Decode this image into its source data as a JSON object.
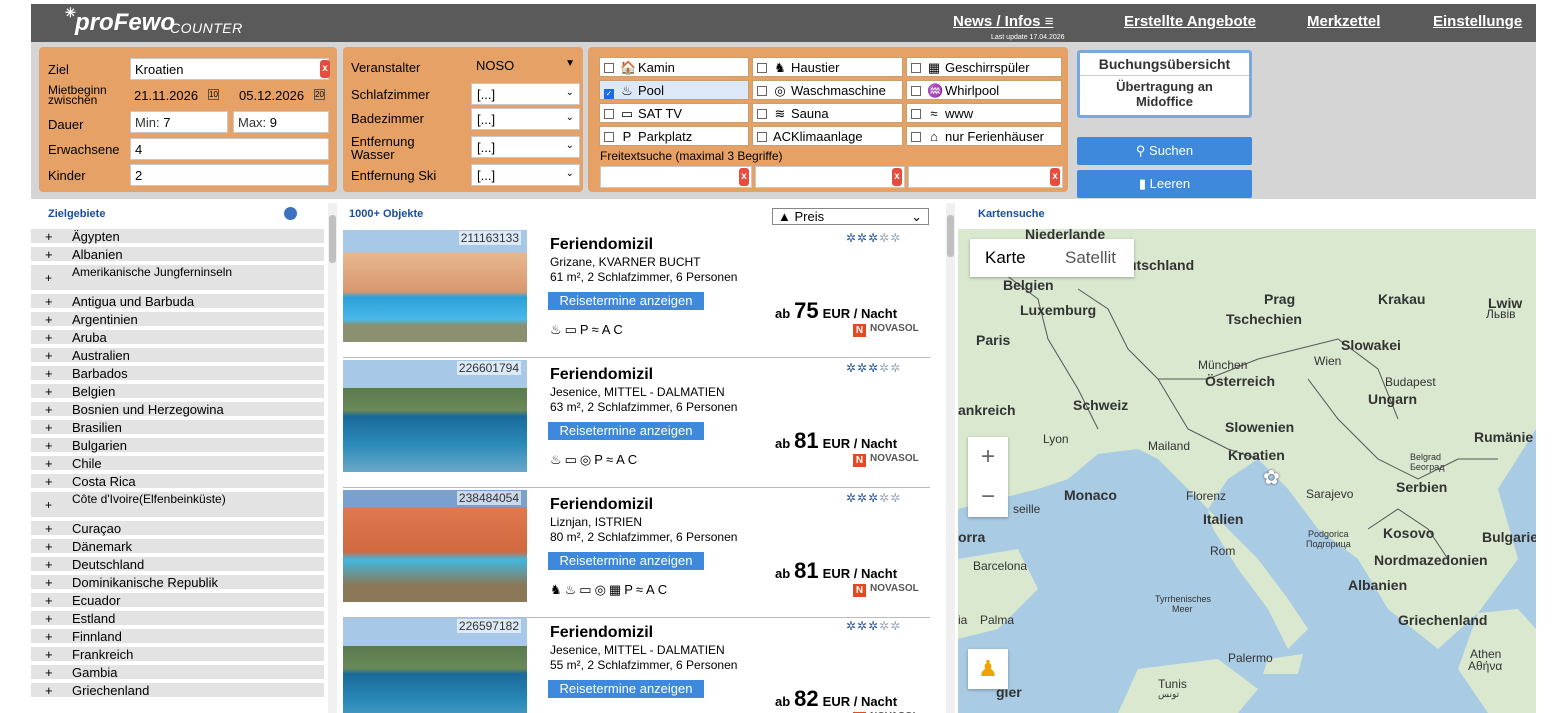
{
  "header": {
    "logo": "proFewo",
    "logo_sub": "COUNTER",
    "nav": [
      "News / Infos",
      "Erstellte Angebote",
      "Merkzettel",
      "Einstellunge"
    ],
    "last_update": "Last update 17.04.2026"
  },
  "search": {
    "ziel_label": "Ziel",
    "ziel_value": "Kroatien",
    "mietbeginn_label": "Mietbeginn zwischen",
    "date_from": "21.11.2026",
    "date_to": "05.12.2026",
    "dauer_label": "Dauer",
    "min_label": "Min:",
    "min_value": "7",
    "max_label": "Max:",
    "max_value": "9",
    "erwachsene_label": "Erwachsene",
    "erwachsene_value": "4",
    "kinder_label": "Kinder",
    "kinder_value": "2",
    "veranstalter_label": "Veranstalter",
    "veranstalter_value": "NOSO",
    "schlafzimmer_label": "Schlafzimmer",
    "schlafzimmer_value": "[...]",
    "badezimmer_label": "Badezimmer",
    "badezimmer_value": "[...]",
    "entfernung_wasser_label": "Entfernung Wasser",
    "entfernung_wasser_value": "[...]",
    "entfernung_ski_label": "Entfernung Ski",
    "entfernung_ski_value": "[...]",
    "amenities": [
      {
        "label": "Kamin",
        "checked": false,
        "icon": "fireplace-icon"
      },
      {
        "label": "Haustier",
        "checked": false,
        "icon": "pet-icon"
      },
      {
        "label": "Geschirrspüler",
        "checked": false,
        "icon": "dishwasher-icon"
      },
      {
        "label": "Pool",
        "checked": true,
        "icon": "pool-icon"
      },
      {
        "label": "Waschmaschine",
        "checked": false,
        "icon": "washing-machine-icon"
      },
      {
        "label": "Whirlpool",
        "checked": false,
        "icon": "whirlpool-icon"
      },
      {
        "label": "SAT TV",
        "checked": false,
        "icon": "tv-icon"
      },
      {
        "label": "Sauna",
        "checked": false,
        "icon": "sauna-icon"
      },
      {
        "label": "www",
        "checked": false,
        "icon": "wifi-icon"
      },
      {
        "label": "Parkplatz",
        "checked": false,
        "icon": "parking-icon"
      },
      {
        "label": "Klimaanlage",
        "checked": false,
        "icon": "ac-icon"
      },
      {
        "label": "nur Ferienhäuser",
        "checked": false,
        "icon": "house-icon"
      }
    ],
    "freitext_label": "Freitextsuche (maximal 3 Begriffe)",
    "buchungsuebersicht": "Buchungsübersicht",
    "uebertragung": "Übertragung an Midoffice",
    "suchen": "Suchen",
    "leeren": "Leeren"
  },
  "sidebar": {
    "title": "Zielgebiete",
    "items": [
      "Ägypten",
      "Albanien",
      "Amerikanische Jungferninseln",
      "Antigua und Barbuda",
      "Argentinien",
      "Aruba",
      "Australien",
      "Barbados",
      "Belgien",
      "Bosnien und Herzegowina",
      "Brasilien",
      "Bulgarien",
      "Chile",
      "Costa Rica",
      "Côte d'Ivoire(Elfenbeinküste)",
      "Curaçao",
      "Dänemark",
      "Deutschland",
      "Dominikanische Republik",
      "Ecuador",
      "Estland",
      "Finnland",
      "Frankreich",
      "Gambia",
      "Griechenland"
    ]
  },
  "results": {
    "count": "1000+ Objekte",
    "sort": "▲ Preis",
    "cards": [
      {
        "id": "211163133",
        "title": "Feriendomizil",
        "location": "Grizane, KVARNER BUCHT",
        "size": "61 m², 2 Schlafzimmer, 6 Personen",
        "button": "Reisetermine anzeigen",
        "price_prefix": "ab",
        "price": "75",
        "price_unit": "EUR / Nacht",
        "amenities": "♨▭P≈AC",
        "brand": "NOVASOL"
      },
      {
        "id": "226601794",
        "title": "Feriendomizil",
        "location": "Jesenice, MITTEL - DALMATIEN",
        "size": "63 m², 2 Schlafzimmer, 6 Personen",
        "button": "Reisetermine anzeigen",
        "price_prefix": "ab",
        "price": "81",
        "price_unit": "EUR / Nacht",
        "amenities": "♨▭◎P≈AC",
        "brand": "NOVASOL"
      },
      {
        "id": "238484054",
        "title": "Feriendomizil",
        "location": "Liznjan, ISTRIEN",
        "size": "80 m², 2 Schlafzimmer, 6 Personen",
        "button": "Reisetermine anzeigen",
        "price_prefix": "ab",
        "price": "81",
        "price_unit": "EUR / Nacht",
        "amenities": "♞♨▭◎▦P≈AC",
        "brand": "NOVASOL"
      },
      {
        "id": "226597182",
        "title": "Feriendomizil",
        "location": "Jesenice, MITTEL - DALMATIEN",
        "size": "55 m², 2 Schlafzimmer, 6 Personen",
        "button": "Reisetermine anzeigen",
        "price_prefix": "ab",
        "price": "82",
        "price_unit": "EUR / Nacht",
        "amenities": "",
        "brand": "NOVASOL"
      }
    ]
  },
  "map": {
    "title": "Kartensuche",
    "karte": "Karte",
    "satellit": "Satellit",
    "zoom_in": "+",
    "zoom_out": "−",
    "labels": [
      "Niederlande",
      "utschland",
      "Belgien",
      "Luxemburg",
      "Prag",
      "Krakau",
      "Lwiw",
      "Львів",
      "Tschechien",
      "Paris",
      "Slowakei",
      "München",
      "Wien",
      "Österreich",
      "Budapest",
      "Ungarn",
      "ankreich",
      "Schweiz",
      "Slowenien",
      "Lyon",
      "Mailand",
      "Rumänie",
      "Kroatien",
      "Belgrad",
      "Београд",
      "Serbien",
      "Monaco",
      "Florenz",
      "Sarajevo",
      "seille",
      "Italien",
      "Kosovo",
      "Bulgarie",
      "orra",
      "Podgorica",
      "Подгорица",
      "Rom",
      "Nordmazedonien",
      "Barcelona",
      "Albanien",
      "Tyrrhenisches",
      "Meer",
      "ia",
      "Palma",
      "Griechenland",
      "Palermo",
      "Athen",
      "Αθήνα",
      "gier",
      "Tunis",
      "تونس"
    ]
  }
}
